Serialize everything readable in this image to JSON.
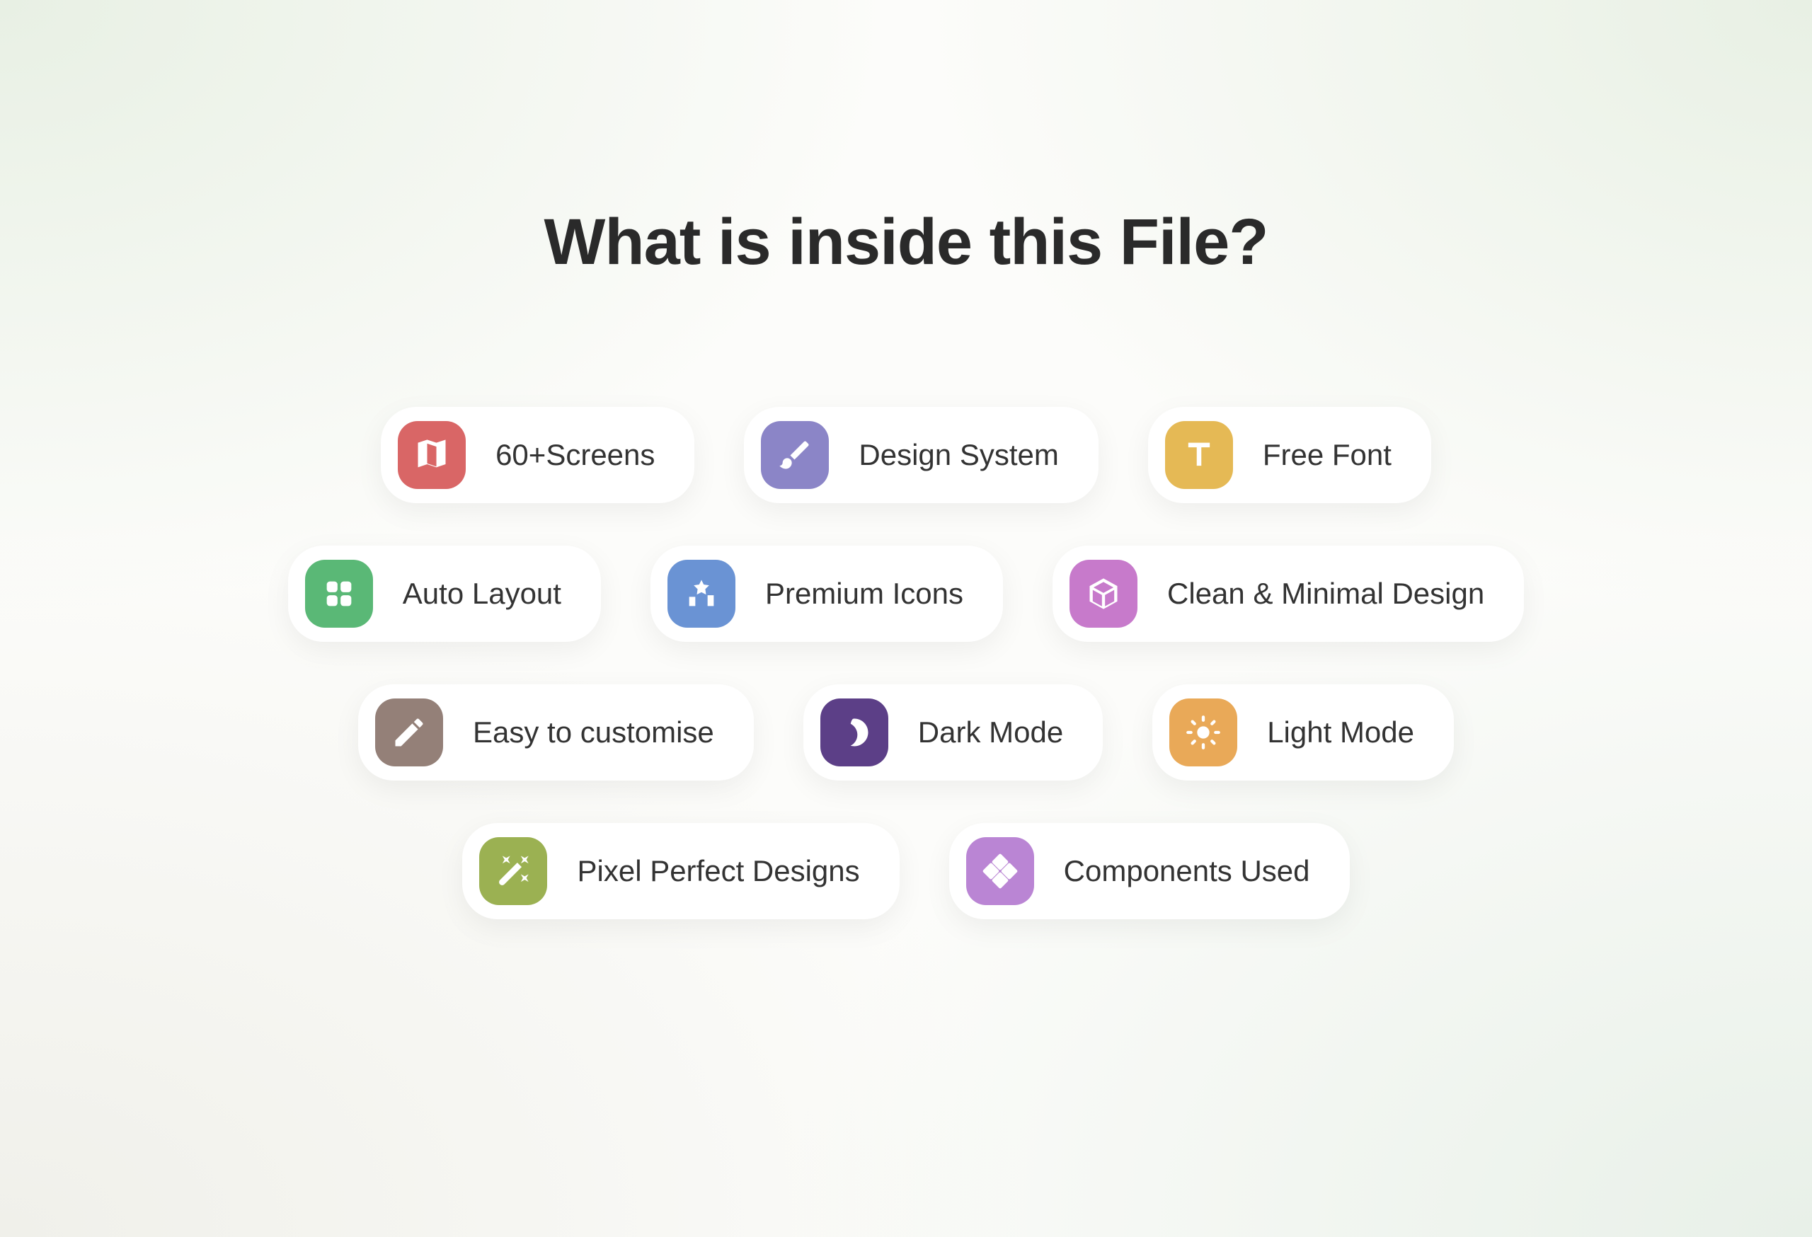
{
  "heading": "What is inside this File?",
  "features": {
    "row1": [
      {
        "label": "60+Screens",
        "icon": "map-icon",
        "color": "bg-red"
      },
      {
        "label": "Design System",
        "icon": "brush-icon",
        "color": "bg-purple"
      },
      {
        "label": "Free Font",
        "icon": "text-icon",
        "color": "bg-yellow"
      }
    ],
    "row2": [
      {
        "label": "Auto Layout",
        "icon": "grid-icon",
        "color": "bg-green"
      },
      {
        "label": "Premium Icons",
        "icon": "media-icon",
        "color": "bg-blue"
      },
      {
        "label": "Clean & Minimal Design",
        "icon": "cube-icon",
        "color": "bg-pink"
      }
    ],
    "row3": [
      {
        "label": "Easy to customise",
        "icon": "edit-icon",
        "color": "bg-brown"
      },
      {
        "label": "Dark Mode",
        "icon": "moon-icon",
        "color": "bg-darkpurple"
      },
      {
        "label": "Light Mode",
        "icon": "sun-icon",
        "color": "bg-orange"
      }
    ],
    "row4": [
      {
        "label": "Pixel Perfect Designs",
        "icon": "magic-icon",
        "color": "bg-olive"
      },
      {
        "label": "Components Used",
        "icon": "diamond-icon",
        "color": "bg-lavender"
      }
    ]
  }
}
